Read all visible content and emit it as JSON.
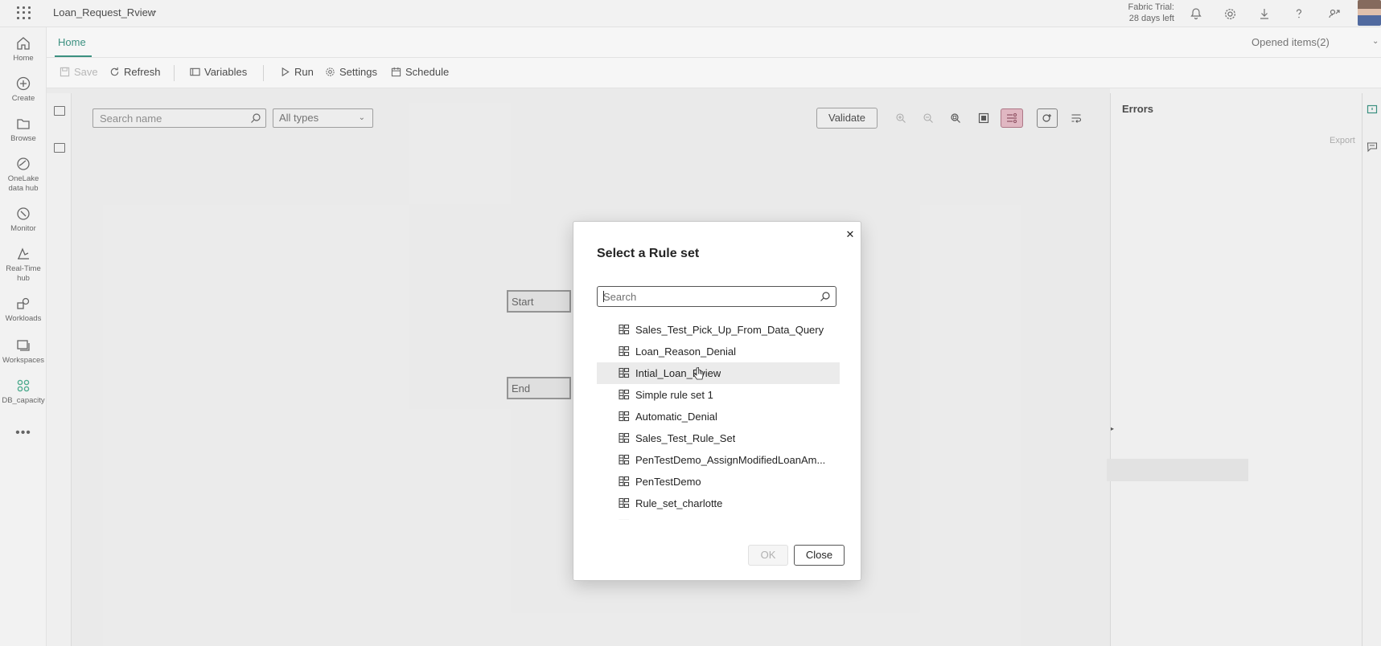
{
  "app": {
    "title": "Loan_Request_Rview",
    "trial_line1": "Fabric Trial:",
    "trial_line2": "28 days left"
  },
  "left_rail": [
    {
      "label": "Home",
      "icon": "home-icon"
    },
    {
      "label": "Create",
      "icon": "plus-circle-icon"
    },
    {
      "label": "Browse",
      "icon": "folder-icon"
    },
    {
      "label": "OneLake data hub",
      "icon": "onelake-icon"
    },
    {
      "label": "Monitor",
      "icon": "monitor-icon"
    },
    {
      "label": "Real-Time hub",
      "icon": "realtime-icon"
    },
    {
      "label": "Workloads",
      "icon": "workloads-icon"
    },
    {
      "label": "Workspaces",
      "icon": "workspaces-icon"
    },
    {
      "label": "DB_capacity",
      "icon": "capacity-icon"
    }
  ],
  "ribbon": {
    "tab_home": "Home",
    "opened_items": "Opened items(2)",
    "save": "Save",
    "refresh": "Refresh",
    "variables": "Variables",
    "run": "Run",
    "settings": "Settings",
    "schedule": "Schedule"
  },
  "canvas": {
    "search_placeholder": "Search name",
    "type_filter": "All types",
    "validate": "Validate",
    "node_start": "Start",
    "node_end": "End"
  },
  "errors_panel": {
    "title": "Errors",
    "export": "Export"
  },
  "dialog": {
    "title": "Select a Rule set",
    "search_placeholder": "Search",
    "items": [
      "Sales_Test_Pick_Up_From_Data_Query",
      "Loan_Reason_Denial",
      "Intial_Loan_Rview",
      "Simple rule set 1",
      "Automatic_Denial",
      "Sales_Test_Rule_Set",
      "PenTestDemo_AssignModifiedLoanAm...",
      "PenTestDemo",
      "Rule_set_charlotte"
    ],
    "hovered_index": 2,
    "ok": "OK",
    "close": "Close"
  }
}
